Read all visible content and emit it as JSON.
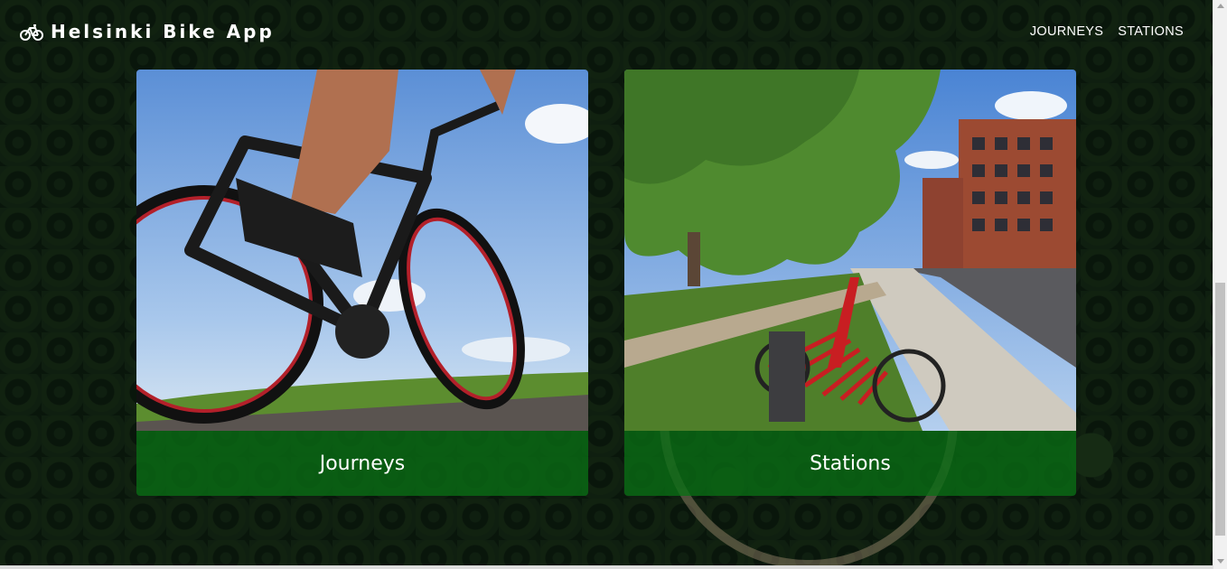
{
  "app": {
    "title": "Helsinki Bike App",
    "icon": "bicycle-icon"
  },
  "nav": {
    "links": [
      {
        "label": "JOURNEYS"
      },
      {
        "label": "STATIONS"
      }
    ]
  },
  "cards": [
    {
      "title": "Journeys",
      "image": "road-cyclist-photo",
      "accent": "#096e14"
    },
    {
      "title": "Stations",
      "image": "bike-share-station-photo",
      "accent": "#096e14"
    }
  ]
}
